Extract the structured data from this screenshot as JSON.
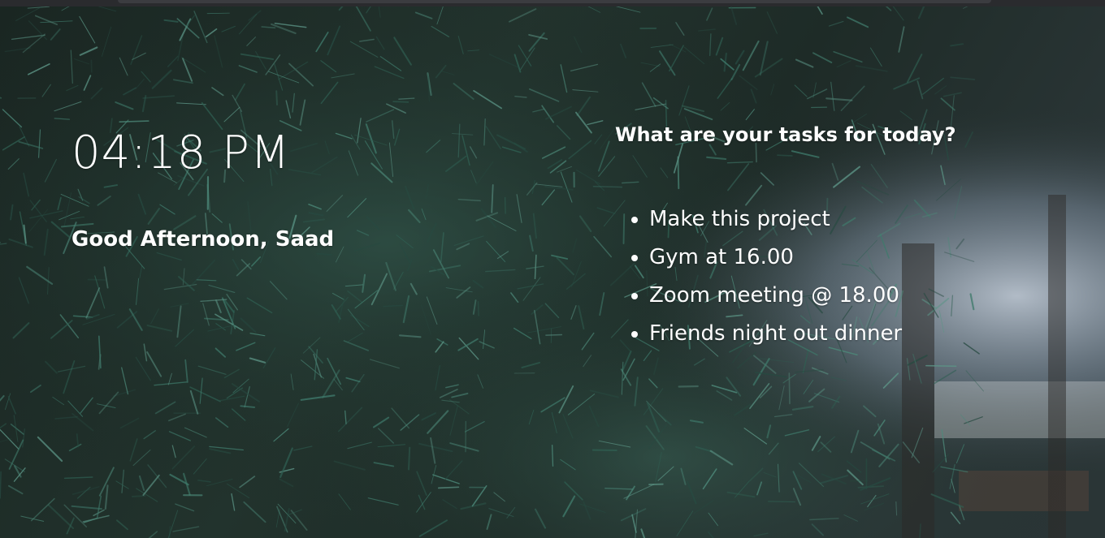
{
  "background": {
    "description_icon": "pine-branches-photo",
    "colors": {
      "dark": "#1b2521",
      "needle": "#3f7a6b",
      "sky": "#b9c7d8"
    }
  },
  "clock": {
    "time": "04:18 PM"
  },
  "greeting": {
    "text": "Good Afternoon, Saad"
  },
  "tasks": {
    "heading": "What are your tasks for today?",
    "items": [
      {
        "label": "Make this project"
      },
      {
        "label": "Gym at 16.00"
      },
      {
        "label": "Zoom meeting @ 18.00"
      },
      {
        "label": "Friends night out dinner"
      }
    ]
  }
}
